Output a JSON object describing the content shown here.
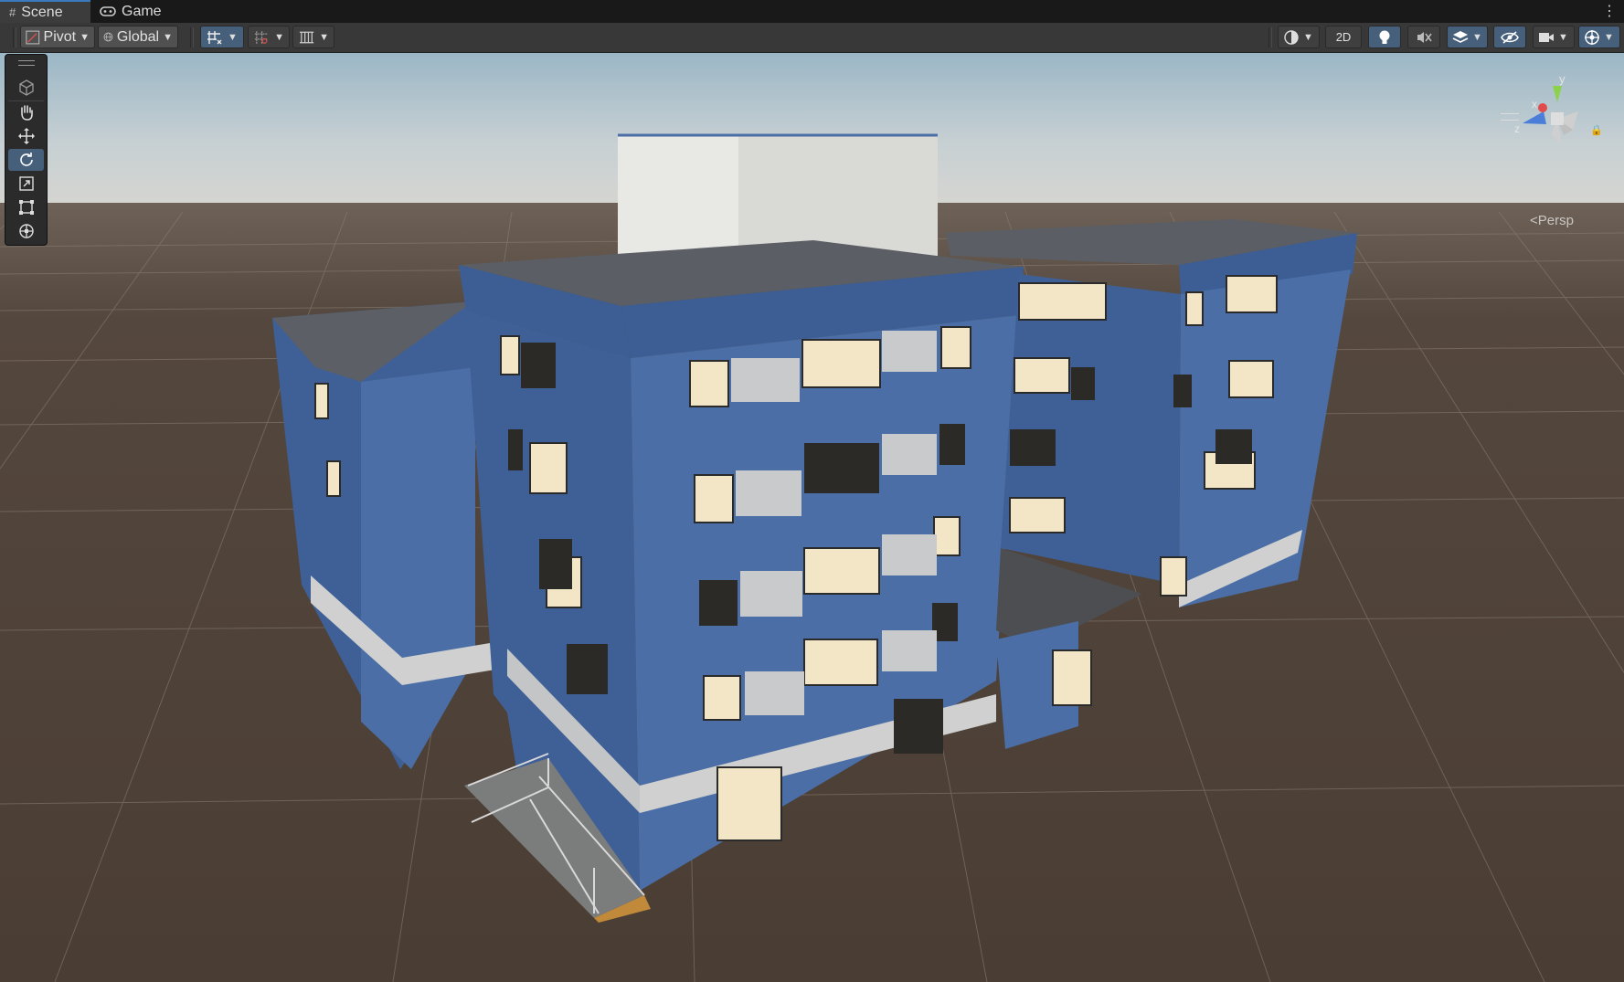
{
  "tabs": [
    {
      "label": "Scene",
      "icon": "hash-icon",
      "active": true
    },
    {
      "label": "Game",
      "icon": "gamepad-icon",
      "active": false
    }
  ],
  "toolbar": {
    "pivot_label": "Pivot",
    "global_label": "Global",
    "two_d_label": "2D"
  },
  "tools": [
    "view-menu-icon",
    "hand-icon",
    "move-icon",
    "rotate-icon",
    "scale-icon",
    "rect-icon",
    "transform-icon"
  ],
  "active_tool": "rotate-icon",
  "gizmo": {
    "axis_y": "y",
    "axis_x": "x",
    "axis_z": "z",
    "projection": "Persp"
  },
  "colors": {
    "accent": "#46607c",
    "toolbar_bg": "#383838",
    "ground": "#4c3f35",
    "building_blue": "#4a6ea5"
  }
}
